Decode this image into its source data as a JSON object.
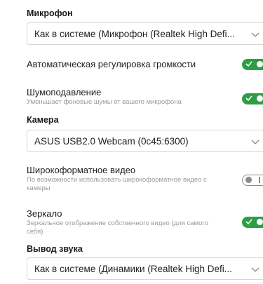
{
  "microphone": {
    "title": "Микрофон",
    "selected": "Как в системе (Микрофон (Realtek High Defi..."
  },
  "auto_gain": {
    "label": "Автоматическая регулировка громкости",
    "enabled": true
  },
  "noise_suppression": {
    "label": "Шумоподавление",
    "description": "Уменьшает фоновые шумы от вашего микрофона",
    "enabled": true
  },
  "camera": {
    "title": "Камера",
    "selected": "ASUS USB2.0 Webcam (0c45:6300)"
  },
  "widescreen": {
    "label": "Широкоформатное видео",
    "description": "По возможности использовать широкоформатное видео с камеры",
    "enabled": false
  },
  "mirror": {
    "label": "Зеркало",
    "description": "Зеркальное отображение собственного видео (для самого себя)",
    "enabled": true
  },
  "audio_output": {
    "title": "Вывод звука",
    "selected": "Как в системе (Динамики (Realtek High Defi..."
  },
  "colors": {
    "toggle_on": "#2e9e44",
    "toggle_off_border": "#8a8a8a",
    "description_text": "#9a9a9a"
  }
}
